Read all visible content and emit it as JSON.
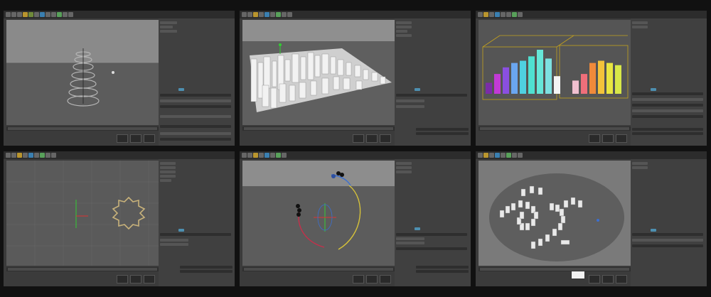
{
  "page": {
    "title": "",
    "background": "#111111"
  },
  "panels": [
    {
      "scene": "helix-spiral",
      "selected_tab_color": "#4d8fb0"
    },
    {
      "scene": "city-blocks",
      "selected_tab_color": "#4d8fb0"
    },
    {
      "scene": "color-bar-histogram",
      "selected_tab_color": "#4d8fb0",
      "bar_colors": [
        "#7b2ca8",
        "#c23ad6",
        "#8a4fe0",
        "#6aa6f0",
        "#4fd0e0",
        "#4fe0d0",
        "#66e6d8",
        "#7de0e0",
        "#f4f4f4",
        "#f0c0d0",
        "#ef6f7a",
        "#f08a3a",
        "#f3c33a",
        "#e8e640",
        "#d8e848"
      ],
      "bar_values": [
        0.25,
        0.45,
        0.6,
        0.7,
        0.75,
        0.85,
        1.0,
        0.8,
        0.4,
        0.3,
        0.45,
        0.7,
        0.75,
        0.7,
        0.65
      ]
    },
    {
      "scene": "star-ring",
      "selected_tab_color": "#4d8fb0"
    },
    {
      "scene": "arc-trail",
      "selected_tab_color": "#4d8fb0"
    },
    {
      "scene": "domino-spiral",
      "selected_tab_color": "#4d8fb0"
    }
  ],
  "icons": [
    "toolbar-icon",
    "play-icon",
    "stop-icon",
    "record-icon"
  ]
}
